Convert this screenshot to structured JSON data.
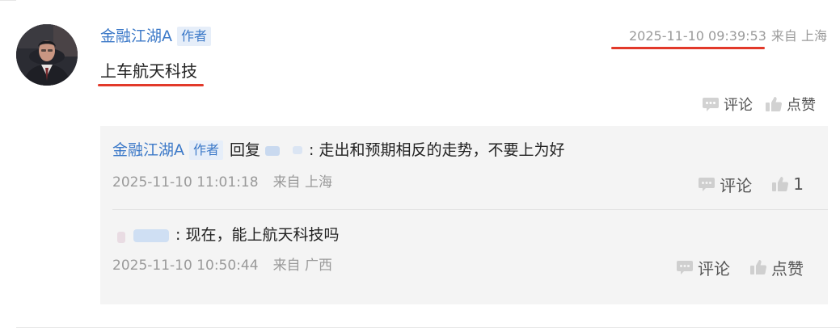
{
  "comment": {
    "avatar_icon": "user-avatar",
    "username": "金融江湖A",
    "author_badge": "作者",
    "timestamp": "2025-11-10 09:39:53",
    "location": "来自 上海",
    "text": "上车航天科技",
    "actions": {
      "comment_icon": "comment-bubble-icon",
      "comment_label": "评论",
      "like_icon": "thumbs-up-icon",
      "like_label": "点赞"
    }
  },
  "replies": [
    {
      "username": "金融江湖A",
      "author_badge": "作者",
      "reply_word": "回复",
      "text": ": 走出和预期相反的走势，不要上为好",
      "timestamp": "2025-11-10 11:01:18",
      "location": "来自 上海",
      "comment_label": "评论",
      "like_count": "1"
    },
    {
      "text": ": 现在，能上航天科技吗",
      "timestamp": "2025-11-10 10:50:44",
      "location": "来自 广西",
      "comment_label": "评论",
      "like_label": "点赞"
    }
  ],
  "colors": {
    "link_blue": "#3c79c8",
    "badge_bg": "#e6eef9",
    "meta_gray": "#9a9a9a",
    "reply_bg": "#f4f4f4",
    "highlight_red": "#e2392a"
  }
}
